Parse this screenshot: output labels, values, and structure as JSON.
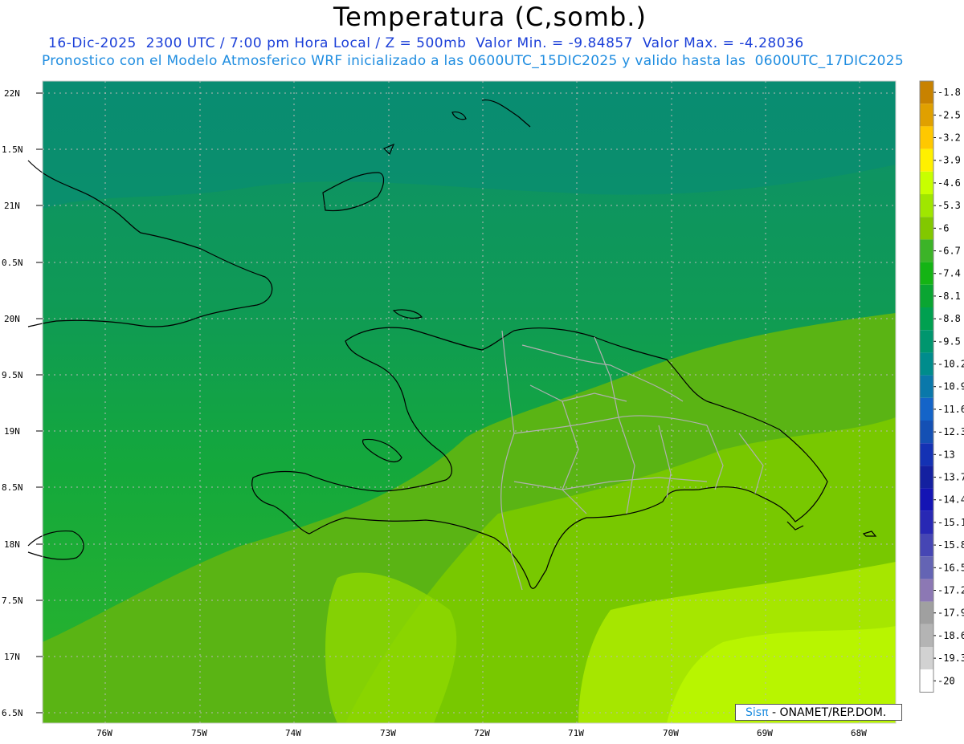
{
  "header": {
    "title": "Temperatura (C,somb.)",
    "line1": "16-Dic-2025  2300 UTC / 7:00 pm Hora Local / Z = 500mb  Valor Min. = -9.84857  Valor Max. = -4.28036",
    "line2": "Pronostico con el Modelo Atmosferico WRF inicializado a las 0600UTC_15DIC2025 y valido hasta las  0600UTC_17DIC2025"
  },
  "map": {
    "lat_labels": [
      "22N",
      "1.5N",
      "21N",
      "0.5N",
      "20N",
      "9.5N",
      "19N",
      "8.5N",
      "18N",
      "7.5N",
      "17N",
      "6.5N"
    ],
    "lon_labels": [
      "76W",
      "75W",
      "74W",
      "73W",
      "72W",
      "71W",
      "70W",
      "69W",
      "68W"
    ],
    "regions": [
      "Cuba",
      "Bahamas",
      "Jamaica",
      "Haiti",
      "Republica Dominicana",
      "Puerto Rico"
    ]
  },
  "colorbar": {
    "labels": [
      "-1.8",
      "-2.5",
      "-3.2",
      "-3.9",
      "-4.6",
      "-5.3",
      "-6",
      "-6.7",
      "-7.4",
      "-8.1",
      "-8.8",
      "-9.5",
      "-10.2",
      "-10.9",
      "-11.6",
      "-12.3",
      "-13",
      "-13.7",
      "-14.4",
      "-15.1",
      "-15.8",
      "-16.5",
      "-17.2",
      "-17.9",
      "-18.6",
      "-19.3",
      "-20"
    ],
    "colors": [
      "#c88200",
      "#e0a000",
      "#ffc800",
      "#fff000",
      "#c8ff00",
      "#a0e600",
      "#82c800",
      "#3cb428",
      "#14b414",
      "#0aa532",
      "#00a050",
      "#00966e",
      "#008c8c",
      "#0a78aa",
      "#1464c8",
      "#1450b4",
      "#1432b4",
      "#1420a0",
      "#1414b4",
      "#2828b4",
      "#4646b4",
      "#6464b4",
      "#8c78b4",
      "#a0a0a0",
      "#b4b4b4",
      "#d2d2d2",
      "#ffffff"
    ]
  },
  "credit": {
    "sis": "Sisπ",
    "text": " - ONAMET/REP.DOM."
  }
}
